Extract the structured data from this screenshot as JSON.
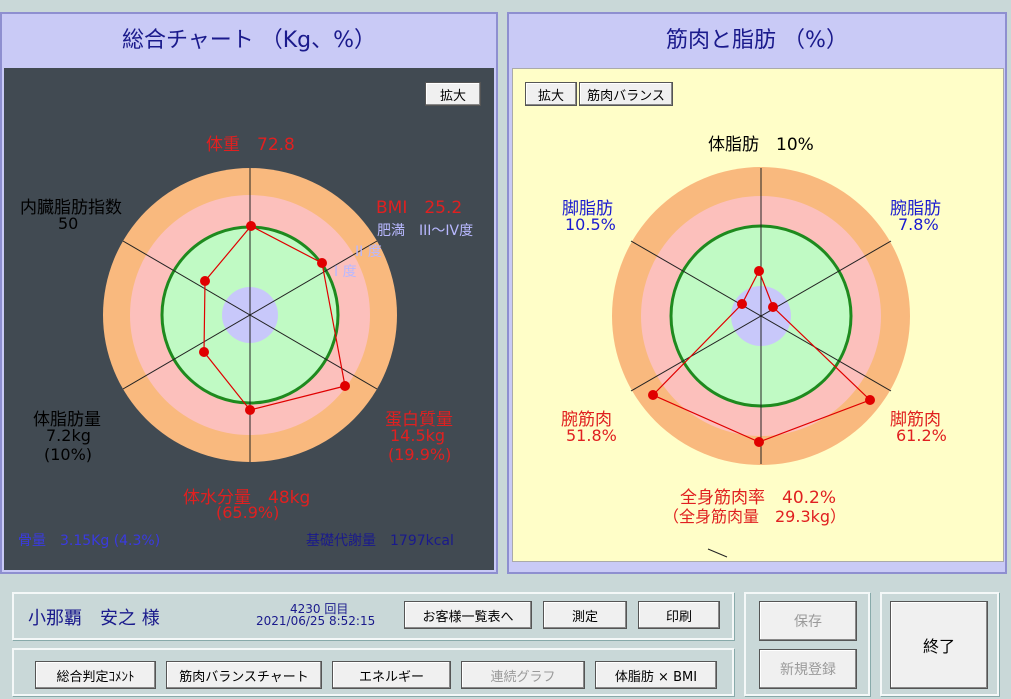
{
  "left_panel": {
    "title": "総合チャート （Kg、%）",
    "zoom_button": "拡大",
    "labels": {
      "weight": "体重　72.8",
      "bmi": "BMI　25.2",
      "obesity_3_4": "肥満　III〜IV度",
      "obesity_2": "II 度",
      "obesity_1": "I 度",
      "visceral_label": "内臓脂肪指数",
      "visceral_value": "50",
      "fat_label": "体脂肪量",
      "fat_value": "7.2kg",
      "fat_pct": "(10%)",
      "protein_label": "蛋白質量",
      "protein_value": "14.5kg",
      "protein_pct": "(19.9%)",
      "water": "体水分量　48kg",
      "water_pct": "(65.9%)",
      "bone": "骨量　3.15Kg (4.3%)",
      "bmr": "基礎代謝量　1797kcal"
    }
  },
  "right_panel": {
    "title": "筋肉と脂肪 （%）",
    "zoom_button": "拡大",
    "balance_button": "筋肉バランス",
    "labels": {
      "body_fat": "体脂肪　10%",
      "leg_fat_label": "脚脂肪",
      "leg_fat_value": "10.5%",
      "arm_fat_label": "腕脂肪",
      "arm_fat_value": "7.8%",
      "arm_muscle_label": "腕筋肉",
      "arm_muscle_value": "51.8%",
      "leg_muscle_label": "脚筋肉",
      "leg_muscle_value": "61.2%",
      "total_muscle_rate": "全身筋肉率　40.2%",
      "total_muscle_mass": "（全身筋肉量　29.3kg）"
    }
  },
  "customer": {
    "name": "小那覇　安之 様",
    "count": "4230 回目",
    "datetime": "2021/06/25 8:52:15"
  },
  "buttons": {
    "customer_list": "お客様一覧表へ",
    "measure": "測定",
    "print": "印刷",
    "save": "保存",
    "new_register": "新規登録",
    "exit": "終了",
    "comment": "総合判定ｺﾒﾝﾄ",
    "muscle_chart": "筋肉バランスチャート",
    "energy": "エネルギー",
    "continuous": "連続グラフ",
    "fat_bmi": "体脂肪 × BMI"
  }
}
